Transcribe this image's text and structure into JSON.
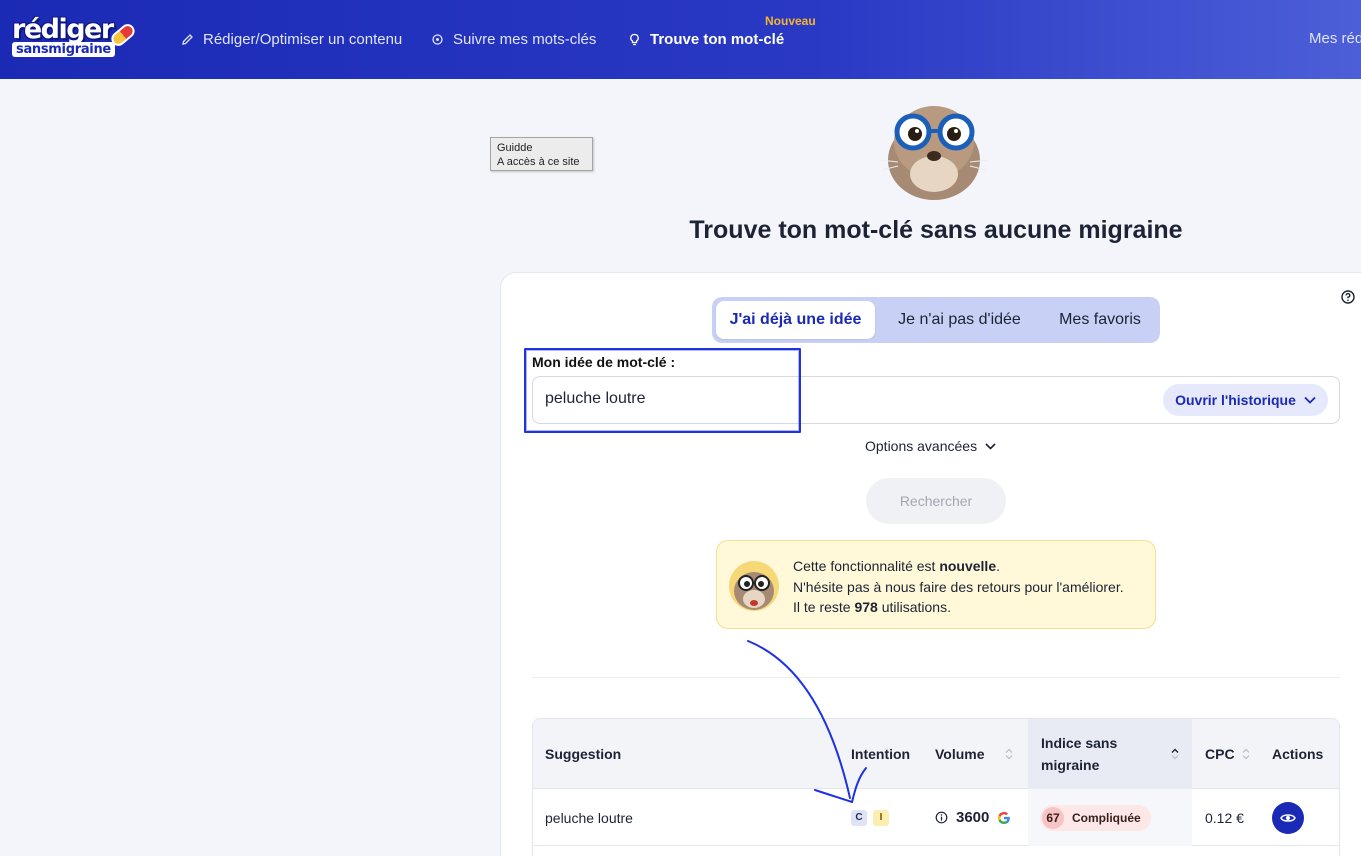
{
  "header": {
    "logo_line1": "rédiger",
    "logo_line2": "sansmigraine",
    "nav": [
      {
        "label": "Rédiger/Optimiser un contenu",
        "icon": "pencil-icon"
      },
      {
        "label": "Suivre mes mots-clés",
        "icon": "target-icon"
      },
      {
        "label": "Trouve ton mot-clé",
        "icon": "lightbulb-icon",
        "badge": "Nouveau"
      }
    ],
    "right_item": "Mes réd"
  },
  "tooltip": {
    "line1": "Guidde",
    "line2": "A accès à ce site"
  },
  "page": {
    "title": "Trouve ton mot-clé sans aucune migraine"
  },
  "tabs": [
    "J'ai déjà une idée",
    "Je n'ai pas d'idée",
    "Mes favoris"
  ],
  "form": {
    "label": "Mon idée de mot-clé :",
    "value": "peluche loutre",
    "history_button": "Ouvrir l'historique",
    "advanced": "Options avancées",
    "search_button": "Rechercher"
  },
  "notice": {
    "l1_pre": "Cette fonctionnalité est ",
    "l1_bold": "nouvelle",
    "l1_post": ".",
    "l2": "N'hésite pas à nous faire des retours pour l'améliorer.",
    "l3_pre": "Il te reste ",
    "l3_bold": "978",
    "l3_post": " utilisations."
  },
  "table": {
    "headers": {
      "suggestion": "Suggestion",
      "intention": "Intention",
      "volume": "Volume",
      "indice": "Indice sans migraine",
      "cpc": "CPC",
      "actions": "Actions"
    },
    "rows": [
      {
        "suggestion": "peluche loutre",
        "intent_1": "C",
        "intent_2": "I",
        "volume": "3600",
        "score": "67",
        "difficulty": "Compliquée",
        "cpc": "0.12 €"
      }
    ]
  },
  "colors": {
    "brand": "#1b2ab4",
    "accent_new": "#f6b52f",
    "notice_bg": "#fff9d9"
  }
}
